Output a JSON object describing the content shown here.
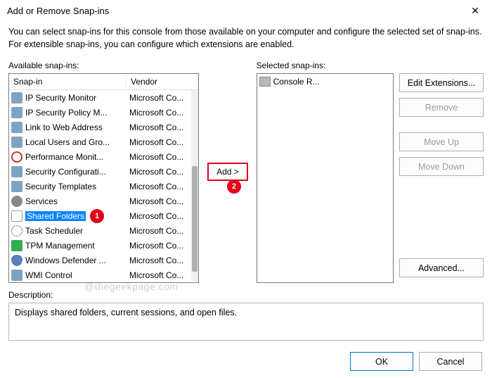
{
  "window": {
    "title": "Add or Remove Snap-ins",
    "close_glyph": "✕"
  },
  "instructions": "You can select snap-ins for this console from those available on your computer and configure the selected set of snap-ins. For extensible snap-ins, you can configure which extensions are enabled.",
  "available": {
    "label": "Available snap-ins:",
    "col_snapin": "Snap-in",
    "col_vendor": "Vendor",
    "items": [
      {
        "name": "IP Security Monitor",
        "vendor": "Microsoft Co...",
        "icon": "mon"
      },
      {
        "name": "IP Security Policy M...",
        "vendor": "Microsoft Co...",
        "icon": "mon"
      },
      {
        "name": "Link to Web Address",
        "vendor": "Microsoft Co...",
        "icon": "mon"
      },
      {
        "name": "Local Users and Gro...",
        "vendor": "Microsoft Co...",
        "icon": "mon"
      },
      {
        "name": "Performance Monit...",
        "vendor": "Microsoft Co...",
        "icon": "perf"
      },
      {
        "name": "Security Configurati...",
        "vendor": "Microsoft Co...",
        "icon": "mon"
      },
      {
        "name": "Security Templates",
        "vendor": "Microsoft Co...",
        "icon": "mon"
      },
      {
        "name": "Services",
        "vendor": "Microsoft Co...",
        "icon": "gear"
      },
      {
        "name": "Shared Folders",
        "vendor": "Microsoft Co...",
        "icon": "cal",
        "selected": true
      },
      {
        "name": "Task Scheduler",
        "vendor": "Microsoft Co...",
        "icon": "clock"
      },
      {
        "name": "TPM Management",
        "vendor": "Microsoft Co...",
        "icon": "chip"
      },
      {
        "name": "Windows Defender ...",
        "vendor": "Microsoft Co...",
        "icon": "shield"
      },
      {
        "name": "WMI Control",
        "vendor": "Microsoft Co...",
        "icon": "mon"
      }
    ]
  },
  "add_button": "Add >",
  "selected": {
    "label": "Selected snap-ins:",
    "items": [
      {
        "name": "Console R..."
      }
    ]
  },
  "side_buttons": {
    "edit_ext": "Edit Extensions...",
    "remove": "Remove",
    "move_up": "Move Up",
    "move_down": "Move Down",
    "advanced": "Advanced..."
  },
  "description": {
    "label": "Description:",
    "text": "Displays shared folders, current sessions, and open files."
  },
  "footer": {
    "ok": "OK",
    "cancel": "Cancel"
  },
  "callouts": {
    "c1": "1",
    "c2": "2"
  },
  "watermark": "@thegeekpage.com"
}
